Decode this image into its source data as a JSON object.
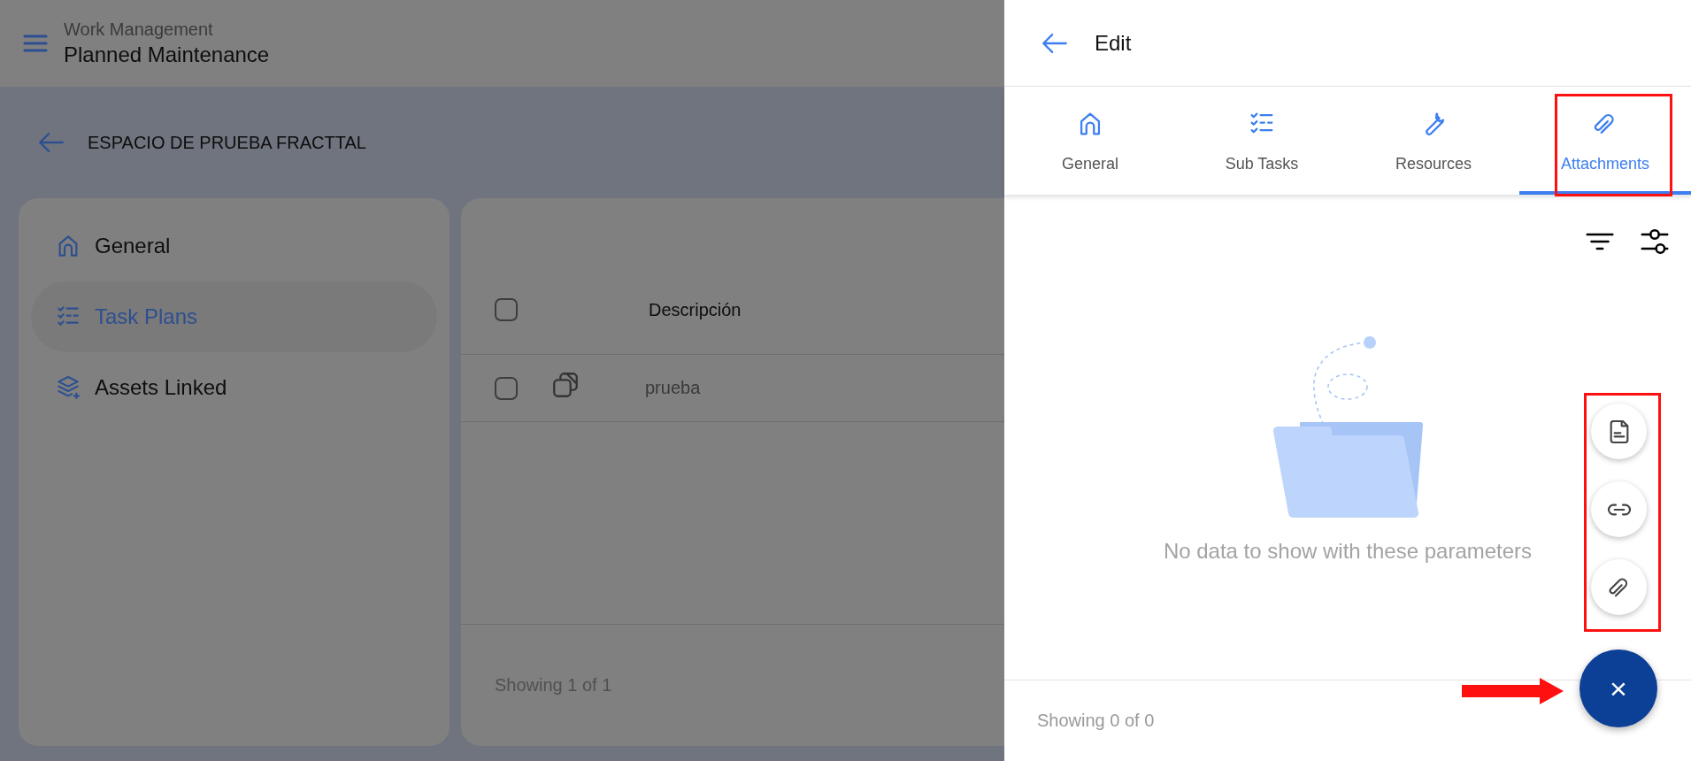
{
  "header": {
    "module": "Work Management",
    "title": "Planned Maintenance"
  },
  "breadcrumb": {
    "title": "ESPACIO DE PRUEBA FRACTTAL"
  },
  "sidebar": {
    "items": [
      {
        "label": "General",
        "selected": false
      },
      {
        "label": "Task Plans",
        "selected": true
      },
      {
        "label": "Assets Linked",
        "selected": false
      }
    ]
  },
  "table": {
    "header_checked": false,
    "columns": [
      "Descripción"
    ],
    "rows": [
      {
        "checked": false,
        "description": "prueba"
      }
    ],
    "footer": "Showing 1 of 1"
  },
  "drawer": {
    "title": "Edit",
    "tabs": [
      {
        "label": "General",
        "selected": false
      },
      {
        "label": "Sub Tasks",
        "selected": false
      },
      {
        "label": "Resources",
        "selected": false
      },
      {
        "label": "Attachments",
        "selected": true
      }
    ],
    "empty_message": "No data to show with these parameters",
    "footer": "Showing 0 of 0",
    "fab": {
      "label": "×"
    }
  }
}
